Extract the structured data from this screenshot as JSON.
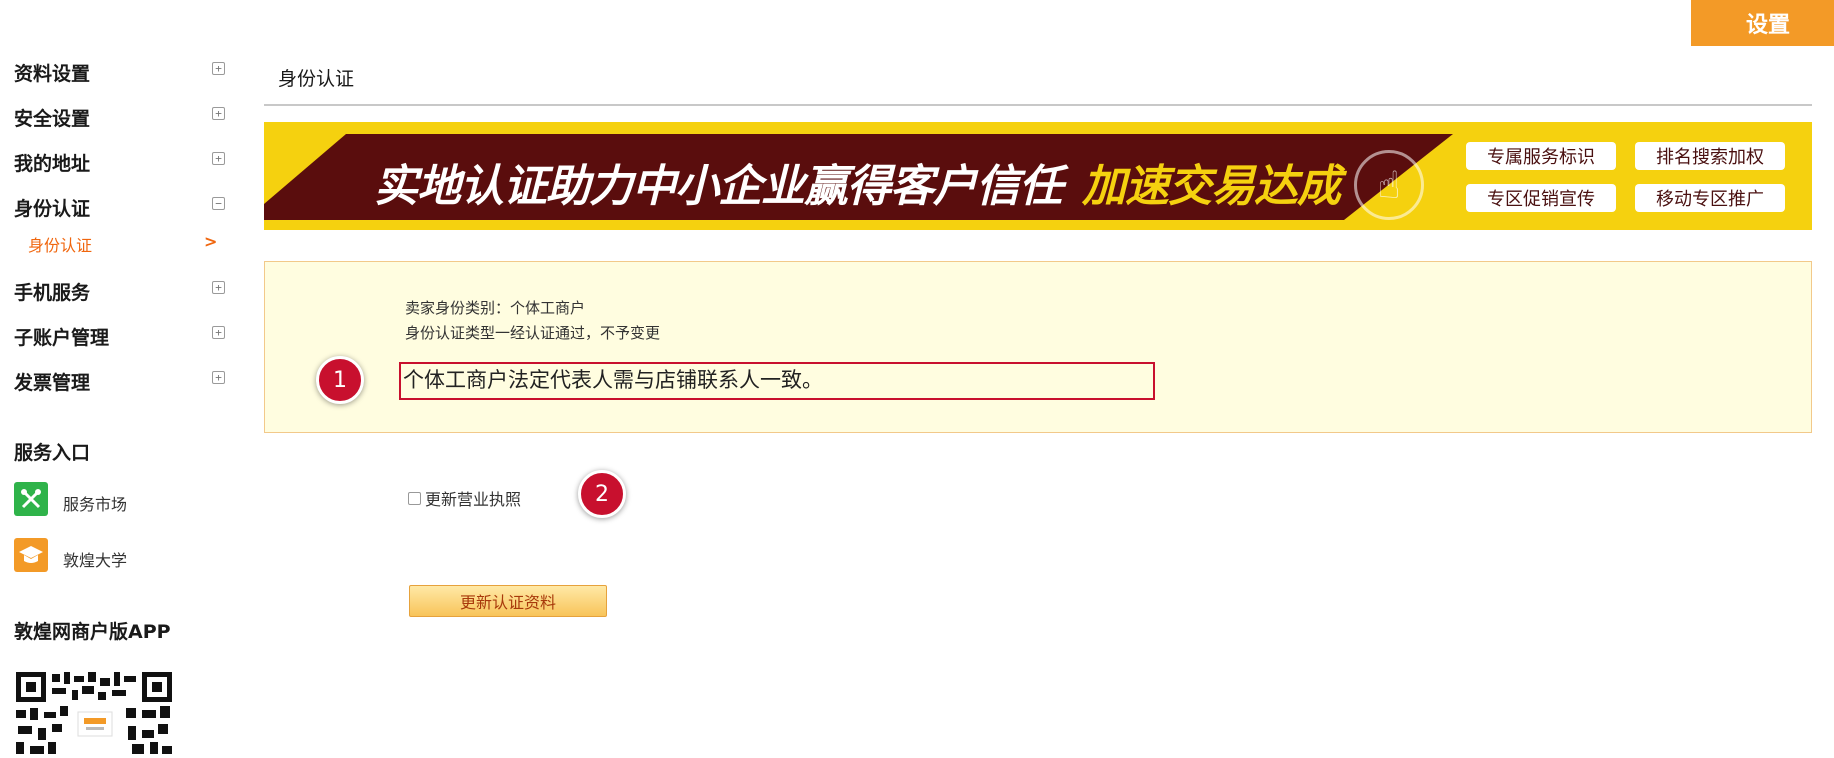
{
  "header": {
    "settings_label": "设置"
  },
  "sidebar": {
    "items": [
      {
        "label": "资料设置",
        "toggle": "+"
      },
      {
        "label": "安全设置",
        "toggle": "+"
      },
      {
        "label": "我的地址",
        "toggle": "+"
      },
      {
        "label": "身份认证",
        "toggle": "−"
      },
      {
        "label": "手机服务",
        "toggle": "+"
      },
      {
        "label": "子账户管理",
        "toggle": "+"
      },
      {
        "label": "发票管理",
        "toggle": "+"
      }
    ],
    "active_sub_item": {
      "label": "身份认证",
      "arrow": ">"
    },
    "services_title": "服务入口",
    "services": [
      {
        "label": "服务市场",
        "icon": "tools-icon",
        "color": "#2fb34a"
      },
      {
        "label": "敦煌大学",
        "icon": "graduation-cap-icon",
        "color": "#f39a27"
      }
    ],
    "app_title": "敦煌网商户版APP"
  },
  "main": {
    "title": "身份认证",
    "banner": {
      "headline": "实地认证助力中小企业赢得客户信任",
      "highlight": "加速交易达成",
      "tags": [
        "专属服务标识",
        "排名搜索加权",
        "专区促销宣传",
        "移动专区推广"
      ]
    },
    "notice": {
      "seller_type": "卖家身份类别：个体工商户",
      "type_note": "身份认证类型一经认证通过，不予变更",
      "main_text": "个体工商户法定代表人需与店铺联系人一致。"
    },
    "checkbox_label": "更新营业执照",
    "update_button": "更新认证资料"
  },
  "annotations": {
    "marker_1": "1",
    "marker_2": "2"
  },
  "colors": {
    "accent": "#f39a27",
    "highlight_red": "#c8102e",
    "active_link": "#f0660e"
  }
}
